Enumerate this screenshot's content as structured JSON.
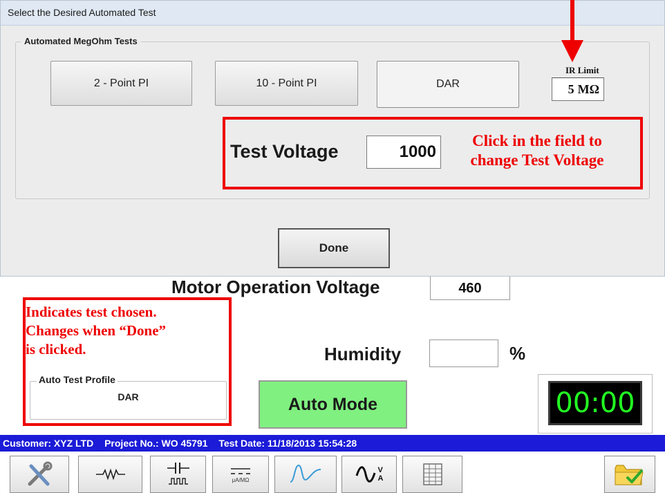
{
  "dialog": {
    "title": "Select the Desired Automated Test",
    "group_title": "Automated MegOhm Tests",
    "tests": [
      "2 - Point PI",
      "10 - Point PI",
      "DAR"
    ],
    "selected_test": "DAR",
    "ir_limit": {
      "label": "IR Limit",
      "value": "5",
      "unit": "MΩ"
    },
    "test_voltage": {
      "label": "Test Voltage",
      "value": "1000"
    },
    "done_label": "Done"
  },
  "annotations": {
    "voltage_line1": "Click in the field to",
    "voltage_line2": "change Test Voltage",
    "test_line1": "Indicates test chosen.",
    "test_line2": "Changes when “Done”",
    "test_line3": "is clicked."
  },
  "main": {
    "motor_operation_voltage": {
      "label": "Motor Operation Voltage",
      "value": "460"
    },
    "humidity": {
      "label": "Humidity",
      "value": "",
      "unit": "%"
    },
    "auto_test_profile": {
      "label": "Auto Test Profile",
      "value": "DAR"
    },
    "auto_mode_label": "Auto Mode",
    "timer": "00:00"
  },
  "status_bar": {
    "customer": "Customer: XYZ LTD",
    "project": "Project No.: WO 45791",
    "test_date": "Test Date: 11/18/2013 15:54:28"
  },
  "toolbar": {
    "icons": [
      "tools-icon",
      "resistor-icon",
      "capacitor-icon",
      "ua-mohm-icon",
      "waveform-icon",
      "sine-va-icon",
      "grid-icon",
      "folder-check-icon"
    ],
    "resistor_sub": "",
    "ua_label": "μA/MΩ",
    "v_label": "V",
    "a_label": "A"
  },
  "colors": {
    "annotation": "#ee0000",
    "status_bar": "#1b1bd8",
    "auto_mode": "#80f080",
    "timer_digits": "#22ff22"
  }
}
